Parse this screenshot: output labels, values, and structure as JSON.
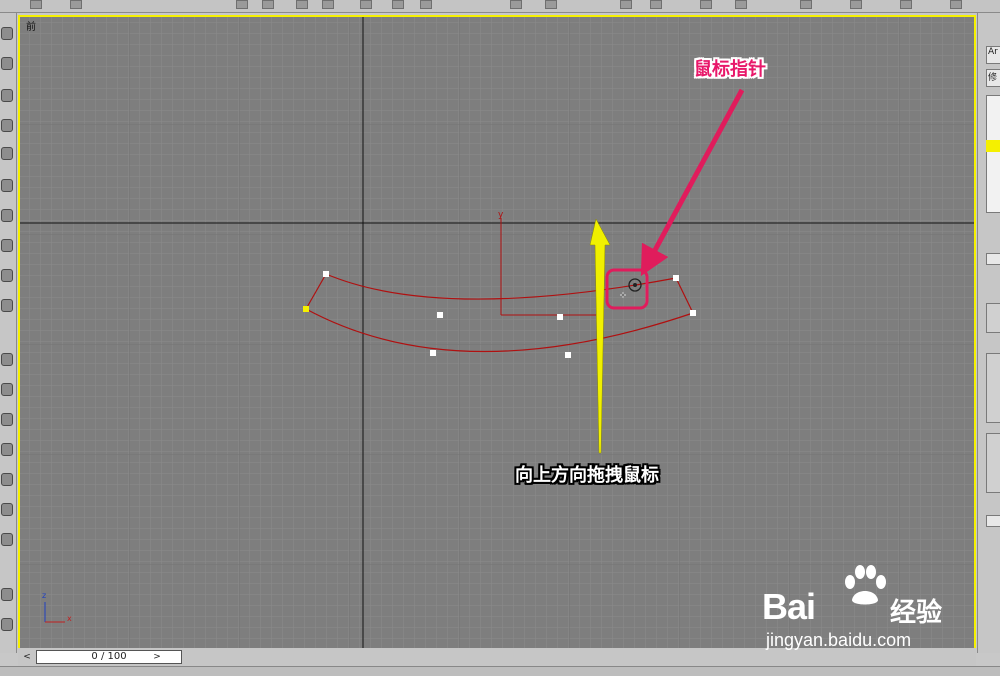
{
  "viewport": {
    "label": "前",
    "axis_y": "y",
    "gizmo_z": "z",
    "gizmo_x": "x"
  },
  "annotations": {
    "pointer_caption": "鼠标指针",
    "drag_caption": "向上方向拖拽鼠标"
  },
  "timeline": {
    "frame_display": "0 / 100",
    "prev_arrow": "<",
    "next_arrow": ">"
  },
  "right_panel": {
    "field1": "Ar",
    "field2": "修"
  },
  "watermark": {
    "brand": "Bai",
    "brand_cn": "经验",
    "url": "jingyan.baidu.com"
  },
  "colors": {
    "viewport_bg": "#7e7e7e",
    "active_border": "#f5f000",
    "spline": "#b01010",
    "pointer_arrow": "#e01c5c",
    "drag_arrow": "#f0f000"
  }
}
